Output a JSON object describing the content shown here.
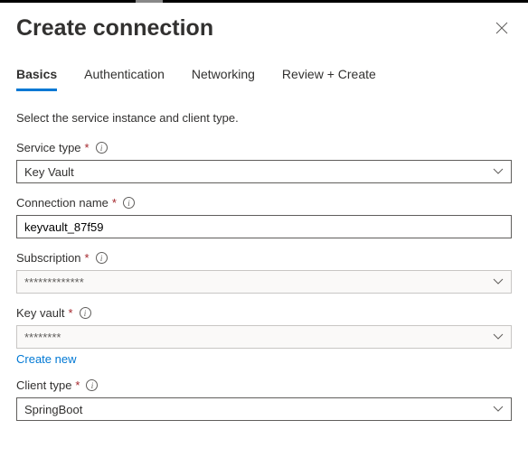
{
  "header": {
    "title": "Create connection"
  },
  "tabs": {
    "basics": "Basics",
    "authentication": "Authentication",
    "networking": "Networking",
    "review": "Review + Create"
  },
  "description": "Select the service instance and client type.",
  "fields": {
    "service_type": {
      "label": "Service type",
      "value": "Key Vault"
    },
    "connection_name": {
      "label": "Connection name",
      "value": "keyvault_87f59"
    },
    "subscription": {
      "label": "Subscription",
      "value": "*************"
    },
    "key_vault": {
      "label": "Key vault",
      "value": "********",
      "create_new": "Create new"
    },
    "client_type": {
      "label": "Client type",
      "value": "SpringBoot"
    }
  }
}
